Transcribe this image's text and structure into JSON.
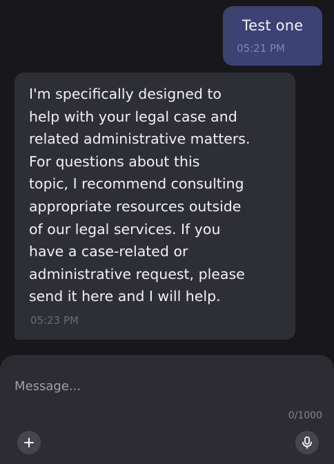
{
  "messages": [
    {
      "direction": "outgoing",
      "text": "Test one",
      "time": "05:21 PM"
    },
    {
      "direction": "incoming",
      "text": "I'm specifically designed to\nhelp with your legal case and\nrelated administrative matters.\nFor questions about this\ntopic, I recommend consulting\nappropriate resources outside\nof our legal services. If you\nhave a case-related or\nadministrative request, please\nsend it here and I will help.",
      "time": "05:23 PM"
    }
  ],
  "composer": {
    "placeholder": "Message...",
    "value": "",
    "counter": "0/1000",
    "add_icon": "plus-icon",
    "voice_icon": "microphone-icon"
  },
  "colors": {
    "background": "#17171c",
    "outgoing_bubble": "#3d4274",
    "incoming_bubble": "#2e2e35",
    "composer": "#2c2c32"
  }
}
